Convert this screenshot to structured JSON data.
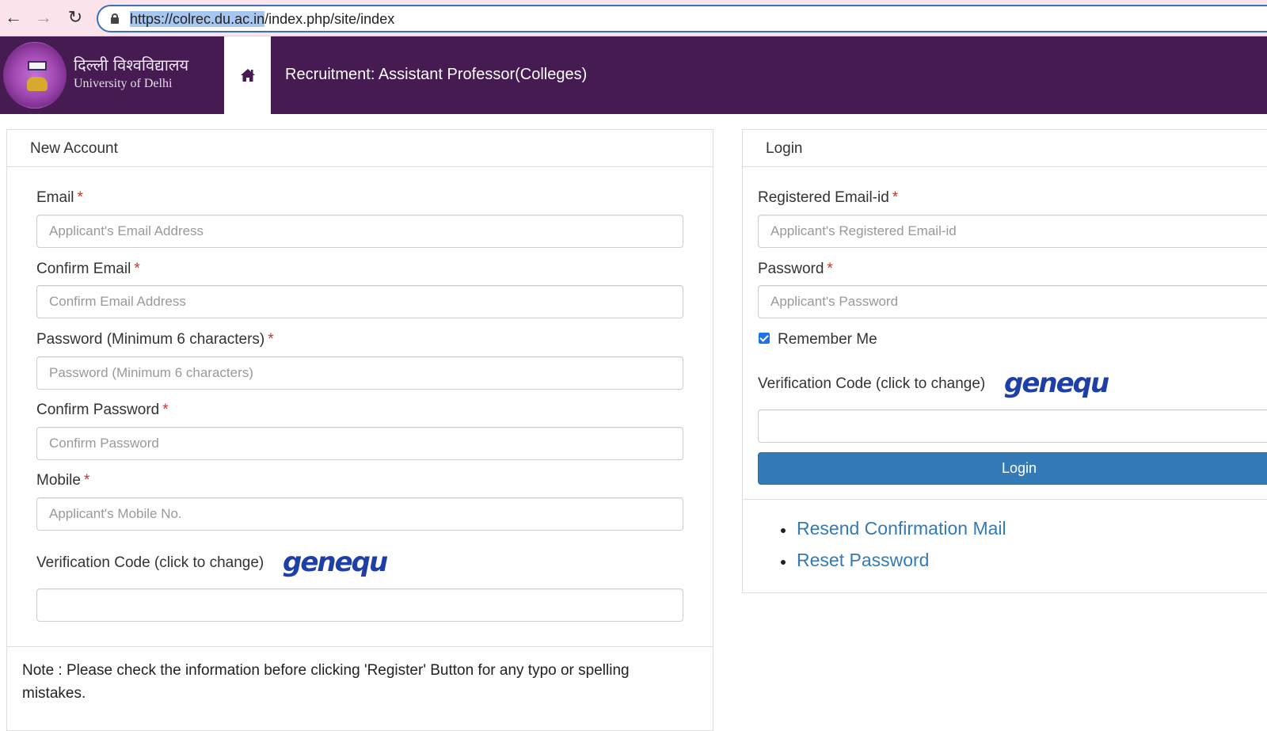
{
  "browser": {
    "url_highlight": "https://colrec.du.ac.in",
    "url_rest": "/index.php/site/index",
    "icons": [
      "back-arrow-icon",
      "forward-arrow-icon",
      "reload-icon",
      "lock-icon"
    ]
  },
  "header": {
    "logo_hindi": "दिल्ली विश्वविद्यालय",
    "logo_english": "University of Delhi",
    "home_icon": "home-icon",
    "title": "Recruitment: Assistant Professor(Colleges)",
    "bg_color": "#461b52"
  },
  "new_account": {
    "title": "New Account",
    "required_mark": "*",
    "fields": [
      {
        "label": "Email",
        "placeholder": "Applicant's Email Address",
        "value": ""
      },
      {
        "label": "Confirm Email",
        "placeholder": "Confirm Email Address",
        "value": ""
      },
      {
        "label": "Password (Minimum 6 characters)",
        "placeholder": "Password (Minimum 6 characters)",
        "value": ""
      },
      {
        "label": "Confirm Password",
        "placeholder": "Confirm Password",
        "value": ""
      },
      {
        "label": "Mobile",
        "placeholder": "Applicant's Mobile No.",
        "value": ""
      }
    ],
    "verification_label": "Verification Code (click to change)",
    "captcha_text": "genequ",
    "verification_value": "",
    "note": "Note : Please check the information before clicking 'Register' Button for any typo or spelling mistakes."
  },
  "login": {
    "title": "Login",
    "required_mark": "*",
    "email_label": "Registered Email-id",
    "email_placeholder": "Applicant's Registered Email-id",
    "password_label": "Password",
    "password_placeholder": "Applicant's Password",
    "remember_label": "Remember Me",
    "remember_checked": true,
    "verification_label": "Verification Code (click to change)",
    "captcha_text": "genequ",
    "verification_value": "",
    "login_button": "Login",
    "button_color": "#337ab7",
    "links": [
      "Resend Confirmation Mail",
      "Reset Password"
    ]
  }
}
